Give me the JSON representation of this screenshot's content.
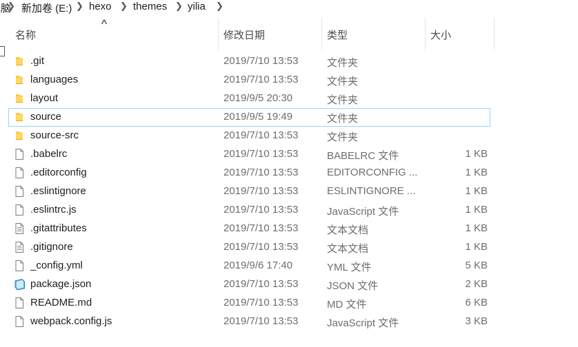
{
  "breadcrumb": {
    "first": "电脑",
    "drive": "新加卷 (E:)",
    "seg1": "hexo",
    "seg2": "themes",
    "seg3": "yilia"
  },
  "columns": {
    "name": "名称",
    "date": "修改日期",
    "type": "类型",
    "size": "大小"
  },
  "files": [
    {
      "name": ".git",
      "date": "2019/7/10 13:53",
      "type": "文件夹",
      "size": "",
      "icon": "folder-icon"
    },
    {
      "name": "languages",
      "date": "2019/7/10 13:53",
      "type": "文件夹",
      "size": "",
      "icon": "folder-icon"
    },
    {
      "name": "layout",
      "date": "2019/9/5 20:30",
      "type": "文件夹",
      "size": "",
      "icon": "folder-icon"
    },
    {
      "name": "source",
      "date": "2019/9/5 19:49",
      "type": "文件夹",
      "size": "",
      "icon": "folder-icon",
      "selected": true
    },
    {
      "name": "source-src",
      "date": "2019/7/10 13:53",
      "type": "文件夹",
      "size": "",
      "icon": "folder-icon"
    },
    {
      "name": ".babelrc",
      "date": "2019/7/10 13:53",
      "type": "BABELRC 文件",
      "size": "1 KB",
      "icon": "file-icon"
    },
    {
      "name": ".editorconfig",
      "date": "2019/7/10 13:53",
      "type": "EDITORCONFIG ...",
      "size": "1 KB",
      "icon": "file-icon"
    },
    {
      "name": ".eslintignore",
      "date": "2019/7/10 13:53",
      "type": "ESLINTIGNORE ...",
      "size": "1 KB",
      "icon": "file-icon"
    },
    {
      "name": ".eslintrc.js",
      "date": "2019/7/10 13:53",
      "type": "JavaScript 文件",
      "size": "1 KB",
      "icon": "file-icon"
    },
    {
      "name": ".gitattributes",
      "date": "2019/7/10 13:53",
      "type": "文本文档",
      "size": "1 KB",
      "icon": "text-file-icon"
    },
    {
      "name": ".gitignore",
      "date": "2019/7/10 13:53",
      "type": "文本文档",
      "size": "1 KB",
      "icon": "text-file-icon"
    },
    {
      "name": "_config.yml",
      "date": "2019/9/6 17:40",
      "type": "YML 文件",
      "size": "5 KB",
      "icon": "file-icon"
    },
    {
      "name": "package.json",
      "date": "2019/7/10 13:53",
      "type": "JSON 文件",
      "size": "2 KB",
      "icon": "json-file-icon"
    },
    {
      "name": "README.md",
      "date": "2019/7/10 13:53",
      "type": "MD 文件",
      "size": "6 KB",
      "icon": "file-icon"
    },
    {
      "name": "webpack.config.js",
      "date": "2019/7/10 13:53",
      "type": "JavaScript 文件",
      "size": "3 KB",
      "icon": "file-icon"
    }
  ],
  "colors": {
    "selection_border": "#99d1ff",
    "folder": "#f7c948",
    "secondary_text": "#6d6d6d"
  }
}
